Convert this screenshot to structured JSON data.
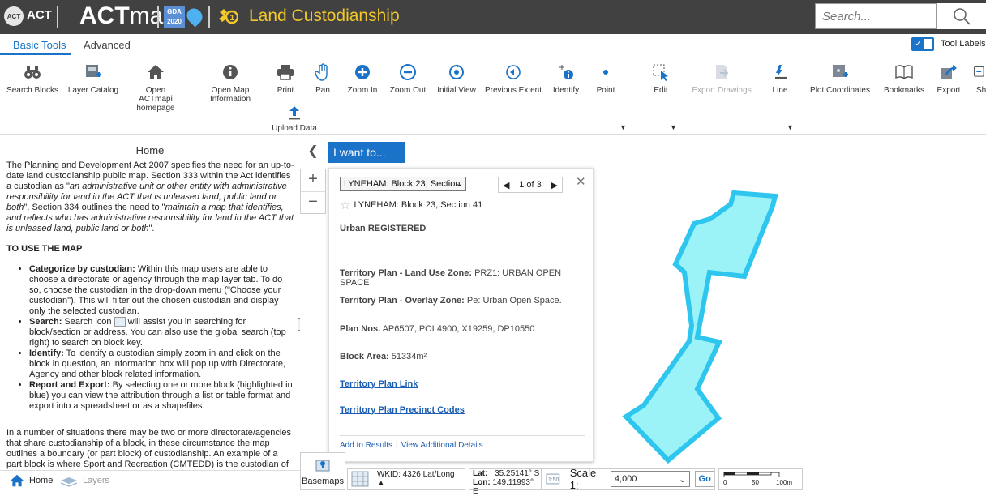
{
  "header": {
    "logo_left_text": "ACT",
    "logo_brand_bold": "ACT",
    "logo_brand_light": "mapi",
    "gda_text": "GDA 2020",
    "app_title": "Land Custodianship",
    "search_placeholder": "Search...",
    "title_color": "#f2c82c",
    "bar_color": "#414141"
  },
  "tabs": {
    "basic": "Basic Tools",
    "advanced": "Advanced",
    "tool_labels": "Tool Labels",
    "tool_labels_on": true
  },
  "toolbar": {
    "search_blocks": "Search Blocks",
    "layer_catalog": "Layer Catalog",
    "open_home": "Open ACTmapi homepage",
    "open_info": "Open Map Information",
    "print": "Print",
    "pan": "Pan",
    "zoom_in": "Zoom In",
    "zoom_out": "Zoom Out",
    "initial_view": "Initial View",
    "previous_extent": "Previous Extent",
    "identify": "Identify",
    "point": "Point",
    "edit": "Edit",
    "export_drawings": "Export Drawings",
    "line": "Line",
    "plot_coordinates": "Plot Coordinates",
    "bookmarks": "Bookmarks",
    "export": "Export",
    "share": "Sh",
    "upload_data": "Upload Data"
  },
  "left_panel": {
    "title": "Home",
    "intro": "The Planning and Development Act 2007 specifies the need for an up-to-date land custodianship public map. Section 333 within the Act identifies a custodian as \"",
    "intro_quote1": "an administrative unit or other entity with administrative responsibility for land in the ACT that is unleased land, public land or both",
    "intro_mid": "\". Section 334 outlines the need to \"",
    "intro_quote2": "maintain a map that identifies, and reflects who has administrative responsibility for land in the ACT that is unleased land, public land or both",
    "intro_end": "\".",
    "howto_heading": "TO USE THE MAP",
    "bullets": [
      {
        "title": "Categorize by custodian:",
        "text": " Within this map users are able to choose a directorate or agency through the map layer tab. To do so, choose the custodian in the drop-down menu (\"Choose your custodian\"). This will filter out the chosen custodian and display only the selected custodian."
      },
      {
        "title": "Search:",
        "text_a": " Search icon ",
        "text_b": " will assist you in searching for block/section or address.  You can also use the global search (top right) to search on block key."
      },
      {
        "title": "Identify:",
        "text": " To identify a custodian simply zoom in and click on the block in question, an information box will pop up with Directorate, Agency and other block related information."
      },
      {
        "title": "Report and Export:",
        "text": " By selecting one or more block (highlighted in blue) you can view the attribution through a list or table format and export into a spreadsheet or as a shapefiles."
      }
    ],
    "closing": "In a number of situations there may be two or more directorate/agencies that share custodianship of a block, in these circumstance the map outlines a boundary (or part block) of custodianship.  An example of a part block is where Sport and Recreation (CMTEDD) is the custodian of the oval and"
  },
  "bottom_tabs": {
    "home": "Home",
    "layers": "Layers"
  },
  "map": {
    "i_want_to": "I want to...",
    "parcel_fill": "#9bf3f7",
    "parcel_stroke": "#2ec6ee"
  },
  "popup": {
    "select_value": "LYNEHAM: Block 23, Section",
    "pager": "1 of 3",
    "title": "LYNEHAM: Block 23, Section 41",
    "status": "Urban REGISTERED",
    "land_use_label": "Territory Plan - Land Use Zone:",
    "land_use_value": "PRZ1: URBAN OPEN SPACE",
    "overlay_label": "Territory Plan - Overlay Zone:",
    "overlay_value": "Pe: Urban Open Space.",
    "plan_label": "Plan Nos.",
    "plan_value": "AP6507, POL4900, X19259, DP10550",
    "area_label": "Block Area:",
    "area_value": "51334m²",
    "link1": "Territory Plan Link",
    "link2": "Territory Plan Precinct Codes",
    "add_results": "Add to Results",
    "view_details": "View Additional Details"
  },
  "status": {
    "basemaps": "Basemaps",
    "wkid": "WKID: 4326 Lat/Long ▲",
    "lat_label": "Lat:",
    "lat_value": "35.25141° S",
    "lon_label": "Lon:",
    "lon_value": "149.11993° E",
    "scale_label": "Scale 1:",
    "scale_value": "4,000",
    "go": "Go",
    "scalebar_0": "0",
    "scalebar_50": "50",
    "scalebar_100": "100m"
  }
}
